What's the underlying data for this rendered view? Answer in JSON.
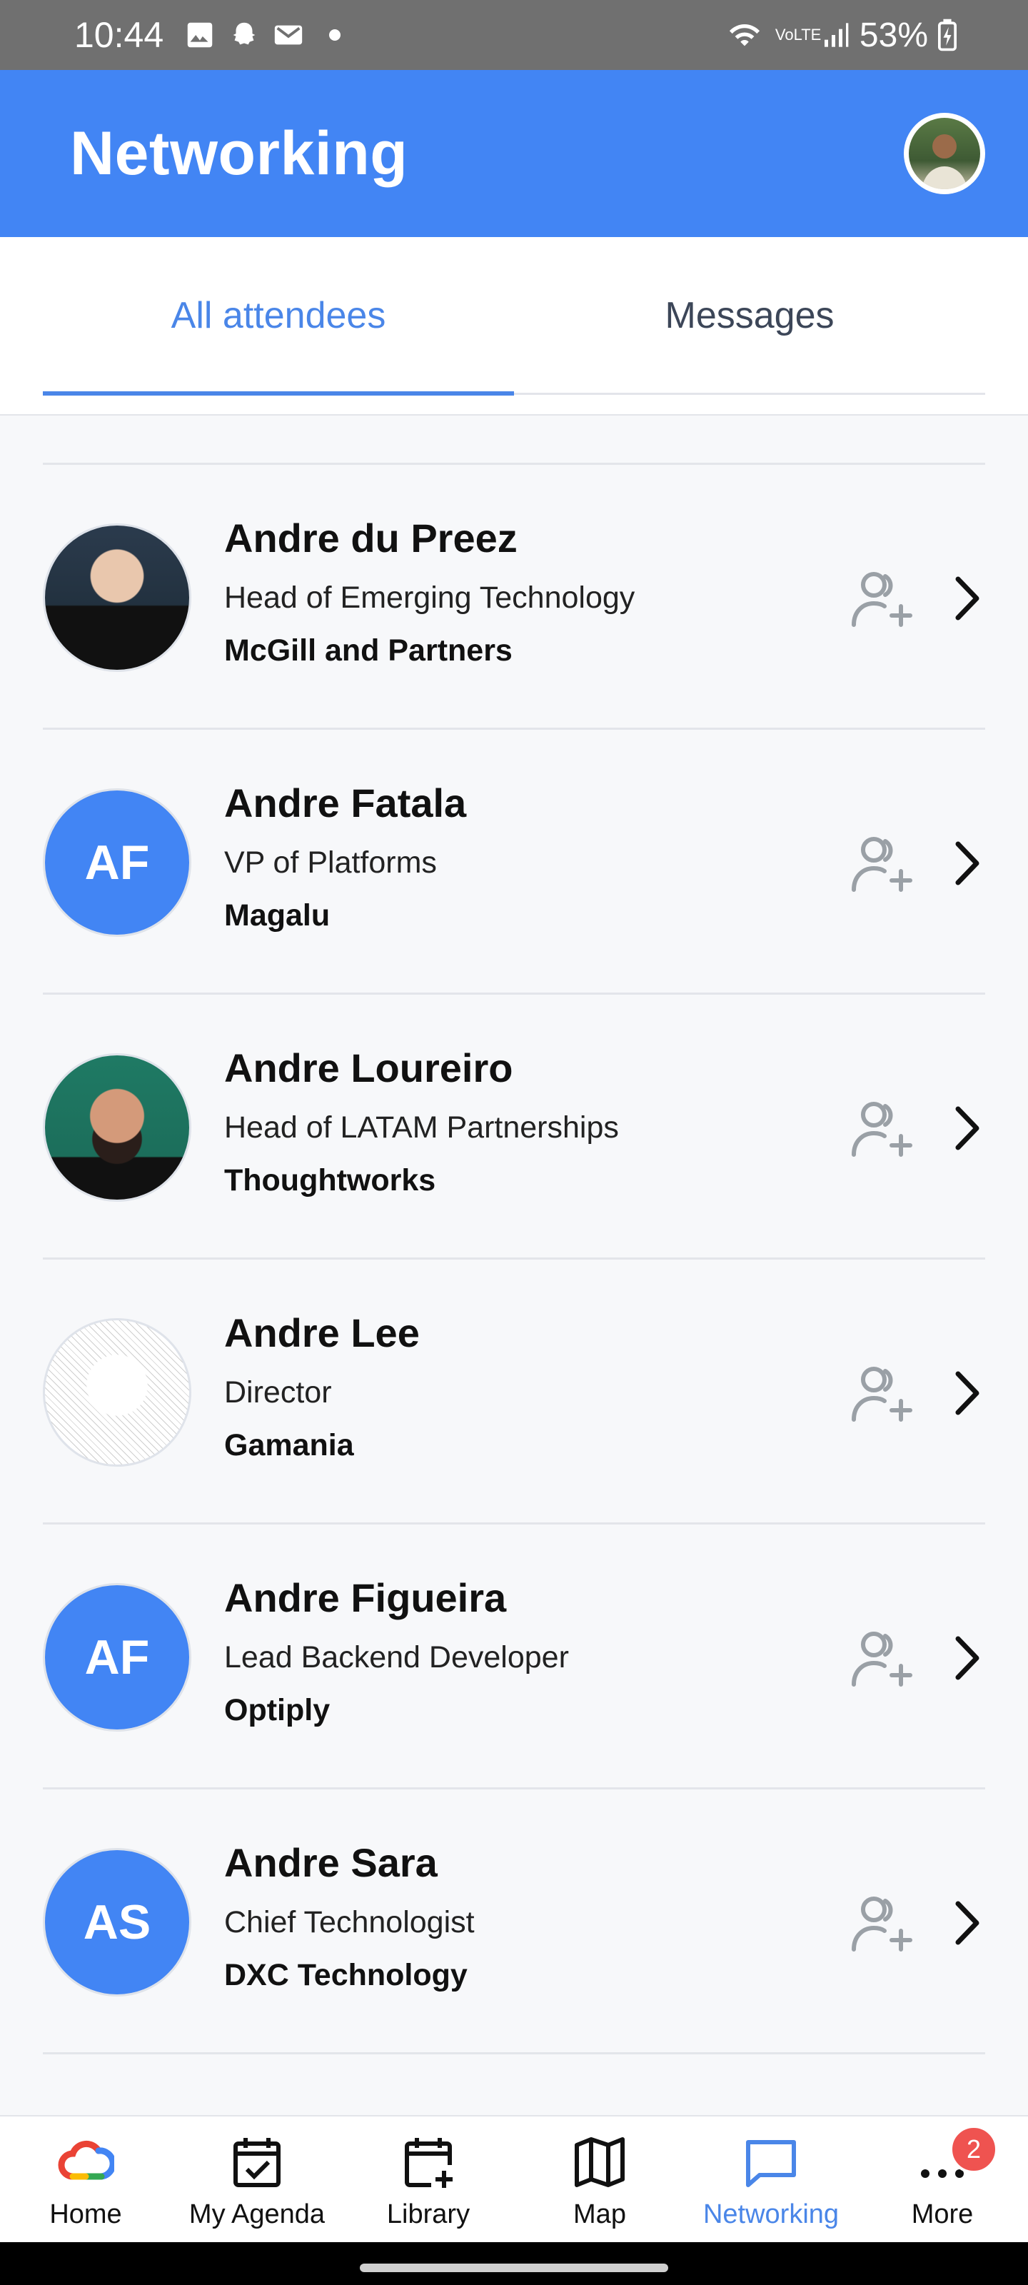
{
  "status_bar": {
    "time": "10:44",
    "battery": "53%",
    "network": "VoLTE"
  },
  "header": {
    "title": "Networking",
    "accent_color": "#4285f4"
  },
  "tabs": [
    {
      "label": "All attendees",
      "active": true
    },
    {
      "label": "Messages",
      "active": false
    }
  ],
  "attendees": [
    {
      "name": "Andre du Preez",
      "title": "Head of Emerging Technology",
      "company": "McGill and Partners",
      "avatar": "photo"
    },
    {
      "name": "Andre Fatala",
      "title": "VP of Platforms",
      "company": "Magalu",
      "avatar": "initials",
      "initials": "AF"
    },
    {
      "name": "Andre Loureiro",
      "title": "Head of LATAM Partnerships",
      "company": "Thoughtworks",
      "avatar": "photo"
    },
    {
      "name": "Andre Lee",
      "title": "Director",
      "company": "Gamania",
      "avatar": "photo"
    },
    {
      "name": "Andre Figueira",
      "title": "Lead Backend Developer",
      "company": "Optiply",
      "avatar": "initials",
      "initials": "AF"
    },
    {
      "name": "Andre Sara",
      "title": "Chief Technologist",
      "company": "DXC Technology",
      "avatar": "initials",
      "initials": "AS"
    }
  ],
  "bottom_nav": [
    {
      "label": "Home",
      "icon": "google-cloud-icon"
    },
    {
      "label": "My Agenda",
      "icon": "calendar-check-icon"
    },
    {
      "label": "Library",
      "icon": "calendar-add-icon"
    },
    {
      "label": "Map",
      "icon": "map-icon"
    },
    {
      "label": "Networking",
      "icon": "chat-icon",
      "active": true
    },
    {
      "label": "More",
      "icon": "more-icon",
      "badge": "2"
    }
  ]
}
